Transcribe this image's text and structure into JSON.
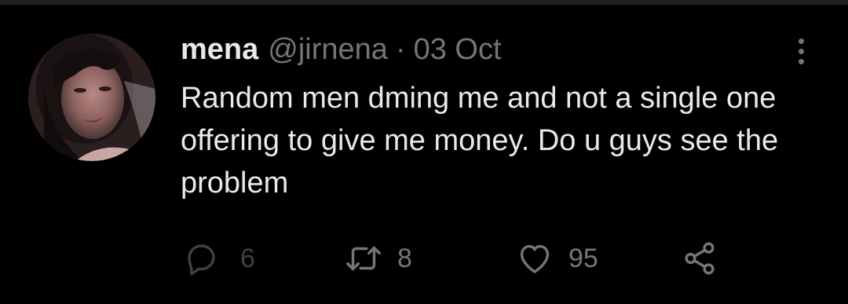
{
  "tweet": {
    "display_name": "mena",
    "handle": "@jirnena",
    "separator": "·",
    "date": "03 Oct",
    "text": "Random men dming me and not a single one offering to give me money. Do u guys see the problem",
    "avatar_icon": "profile-photo",
    "more_icon": "more-vertical-icon"
  },
  "actions": {
    "reply": {
      "icon": "reply-icon",
      "count": "6"
    },
    "retweet": {
      "icon": "retweet-icon",
      "count": "8"
    },
    "like": {
      "icon": "heart-icon",
      "count": "95"
    },
    "share": {
      "icon": "share-icon"
    }
  },
  "colors": {
    "background": "#000000",
    "text_primary": "#e7e9ea",
    "text_secondary": "#71767b",
    "divider": "#1c1f23"
  }
}
